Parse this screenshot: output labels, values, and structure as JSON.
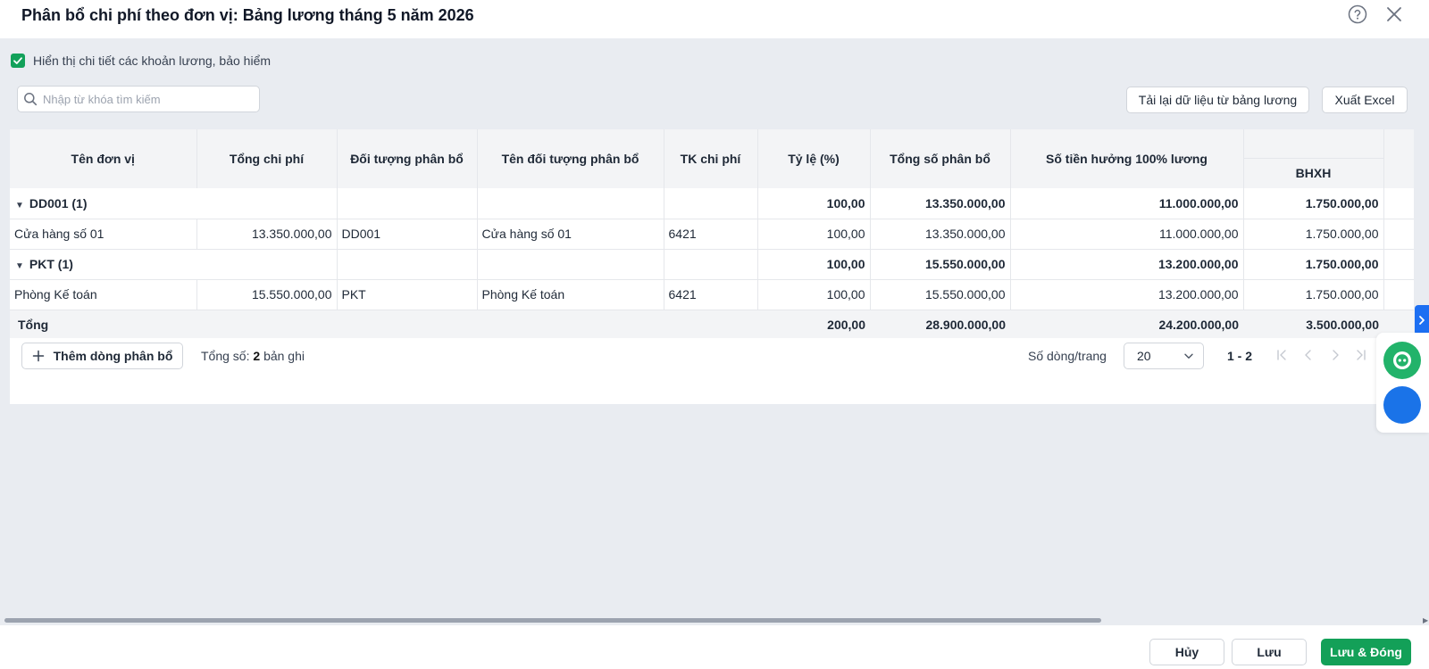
{
  "header": {
    "title": "Phân bổ chi phí theo đơn vị: Bảng lương tháng 5 năm 2026",
    "help_icon": "help-circle-icon",
    "close_icon": "close-icon"
  },
  "options": {
    "show_detail_label": "Hiển thị chi tiết các khoản lương, bảo hiểm",
    "show_detail_checked": true
  },
  "search": {
    "placeholder": "Nhập từ khóa tìm kiếm",
    "value": ""
  },
  "toolbar": {
    "reload_label": "Tải lại dữ liệu từ bảng lương",
    "export_label": "Xuất Excel"
  },
  "table": {
    "columns": {
      "unit_name": "Tên đơn vị",
      "total_cost": "Tổng chi phí",
      "alloc_object": "Đối tượng phân bổ",
      "alloc_object_name": "Tên đối tượng phân bổ",
      "expense_account": "TK chi phí",
      "ratio": "Tỷ lệ (%)",
      "total_allocated": "Tổng số phân bổ",
      "salary_100": "Số tiền hưởng 100% lương",
      "bhxh": "BHXH"
    },
    "groups": [
      {
        "label": "DD001 (1)",
        "ratio": "100,00",
        "total_allocated": "13.350.000,00",
        "salary_100": "11.000.000,00",
        "bhxh": "1.750.000,00",
        "row": {
          "unit_name": "Cửa hàng số 01",
          "total_cost": "13.350.000,00",
          "alloc_object": "DD001",
          "alloc_object_name": "Cửa hàng số 01",
          "expense_account": "6421",
          "ratio": "100,00",
          "total_allocated": "13.350.000,00",
          "salary_100": "11.000.000,00",
          "bhxh": "1.750.000,00"
        }
      },
      {
        "label": "PKT (1)",
        "ratio": "100,00",
        "total_allocated": "15.550.000,00",
        "salary_100": "13.200.000,00",
        "bhxh": "1.750.000,00",
        "row": {
          "unit_name": "Phòng Kế toán",
          "total_cost": "15.550.000,00",
          "alloc_object": "PKT",
          "alloc_object_name": "Phòng Kế toán",
          "expense_account": "6421",
          "ratio": "100,00",
          "total_allocated": "15.550.000,00",
          "salary_100": "13.200.000,00",
          "bhxh": "1.750.000,00"
        }
      }
    ],
    "total": {
      "label": "Tổng",
      "ratio": "200,00",
      "total_allocated": "28.900.000,00",
      "salary_100": "24.200.000,00",
      "bhxh": "3.500.000,00"
    }
  },
  "footer": {
    "add_label": "Thêm dòng phân bổ",
    "count_prefix": "Tổng số:",
    "count_value": "2",
    "count_suffix": "bản ghi",
    "per_page_label": "Số dòng/trang",
    "per_page_value": "20",
    "range": "1 - 2"
  },
  "actions": {
    "cancel_label": "Hủy",
    "save_label": "Lưu",
    "save_close_label": "Lưu & Đóng"
  },
  "colors": {
    "primary_green": "#13a058",
    "accent_blue": "#1a73e8"
  }
}
